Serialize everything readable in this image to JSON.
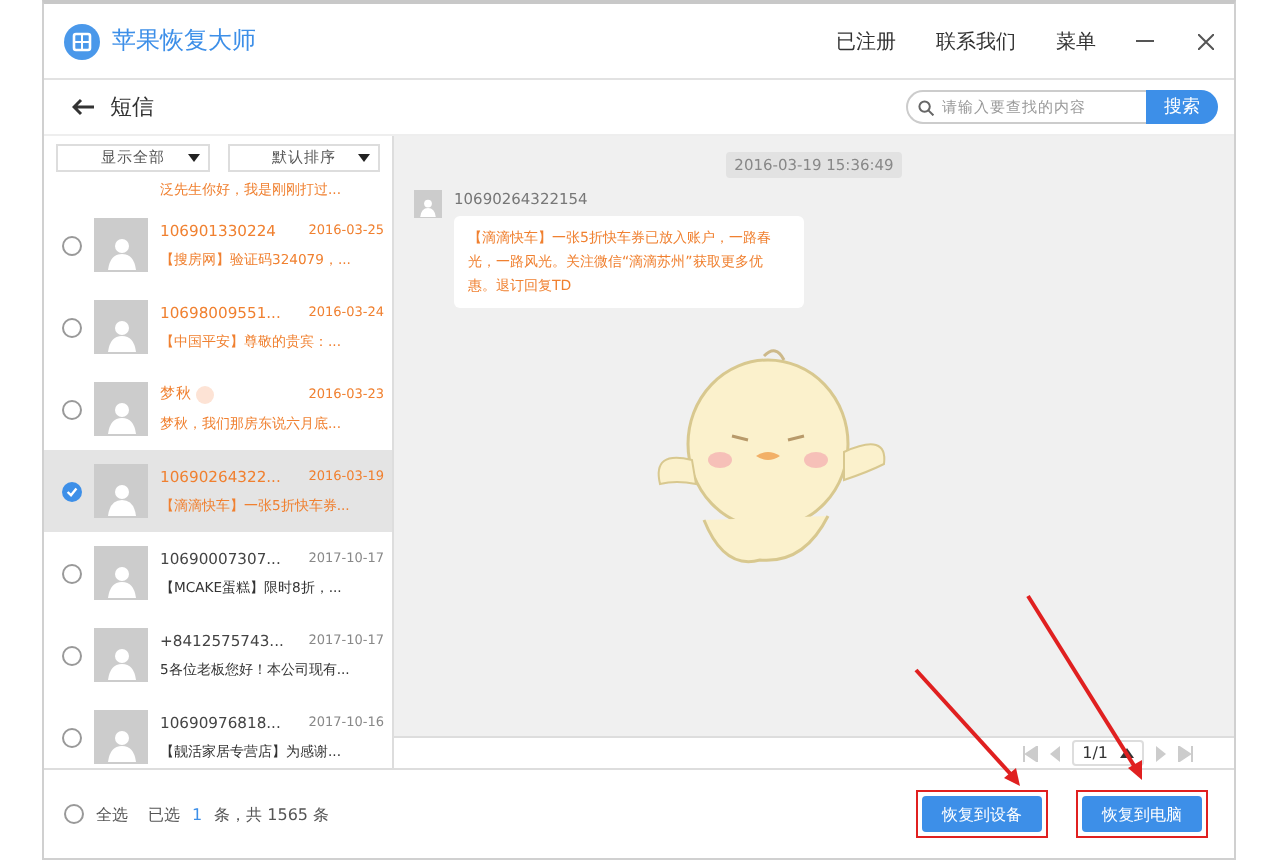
{
  "window": {
    "title": "苹果恢复大师",
    "menu": [
      "已注册",
      "联系我们",
      "菜单"
    ]
  },
  "subheader": {
    "title": "短信",
    "search": {
      "placeholder": "请输入要查找的内容",
      "button": "搜索"
    }
  },
  "filters": [
    "显示全部",
    "默认排序"
  ],
  "messages": [
    {
      "kind": "partial",
      "preview": "泛先生你好，我是刚刚打过...",
      "unread": true
    },
    {
      "kind": "full",
      "sender": "106901330224",
      "date": "2016-03-25",
      "preview": "【搜房网】验证码324079，...",
      "unread": true,
      "checked": false,
      "selected": false
    },
    {
      "kind": "full",
      "sender": "10698009551...",
      "date": "2016-03-24",
      "preview": "【中国平安】尊敬的贵宾：...",
      "unread": true,
      "checked": false,
      "selected": false
    },
    {
      "kind": "full",
      "sender": "梦秋",
      "date": "2016-03-23",
      "preview": "梦秋，我们那房东说六月底...",
      "unread": true,
      "checked": false,
      "selected": false,
      "blurred_mark": true
    },
    {
      "kind": "full",
      "sender": "10690264322...",
      "date": "2016-03-19",
      "preview": "【滴滴快车】一张5折快车券...",
      "unread": true,
      "checked": true,
      "selected": true
    },
    {
      "kind": "full",
      "sender": "10690007307...",
      "date": "2017-10-17",
      "preview": "【MCAKE蛋糕】限时8折，...",
      "unread": false,
      "checked": false,
      "selected": false
    },
    {
      "kind": "full",
      "sender": "+8412575743...",
      "date": "2017-10-17",
      "preview": "5各位老板您好！本公司现有...",
      "unread": false,
      "checked": false,
      "selected": false
    },
    {
      "kind": "full",
      "sender": "10690976818...",
      "date": "2017-10-16",
      "preview": "【靓活家居专营店】为感谢...",
      "unread": false,
      "checked": false,
      "selected": false
    }
  ],
  "conversation": {
    "timestamp": "2016-03-19 15:36:49",
    "sender": "10690264322154",
    "text": "【滴滴快车】一张5折快车券已放入账户，一路春光，一路风光。关注微信“滴滴苏州”获取更多优惠。退订回复TD"
  },
  "pagination": {
    "page": "1/1"
  },
  "footer": {
    "select_all": "全选",
    "select_all_checked": false,
    "selected_prefix": "已选",
    "selected_count": "1",
    "selected_suffix": "条，共 1565 条",
    "buttons": [
      "恢复到设备",
      "恢复到电脑"
    ]
  }
}
